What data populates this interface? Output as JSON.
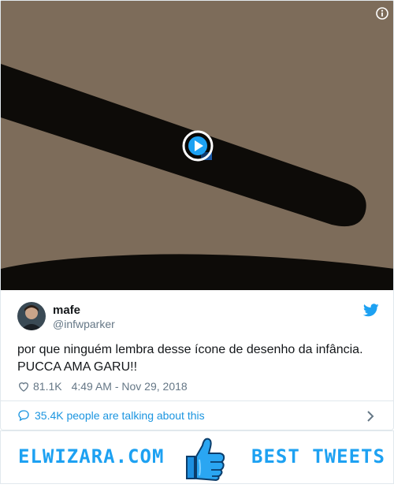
{
  "video": {
    "play_label": "Play video",
    "info_label": "Info"
  },
  "tweet": {
    "author_name": "mafe",
    "author_handle": "@infwparker",
    "text_line1": "por que ninguém lembra desse ícone de desenho da infância.",
    "text_line2": "PUCCA AMA GARU!!",
    "likes": "81.1K",
    "timestamp": "4:49 AM - Nov 29, 2018"
  },
  "conversation": {
    "label": "35.4K people are talking about this"
  },
  "banner": {
    "brand": "ELWIZARA.COM",
    "tagline": "BEST TWEETS"
  },
  "colors": {
    "accent": "#1da1f2",
    "link": "#1b95e0",
    "muted": "#657786",
    "media_bg": "#7a6a58"
  },
  "icons": [
    "info-icon",
    "play-icon",
    "twitter-bird-icon",
    "heart-icon",
    "comment-bubble-icon",
    "chevron-right-icon",
    "thumbs-up-icon"
  ]
}
